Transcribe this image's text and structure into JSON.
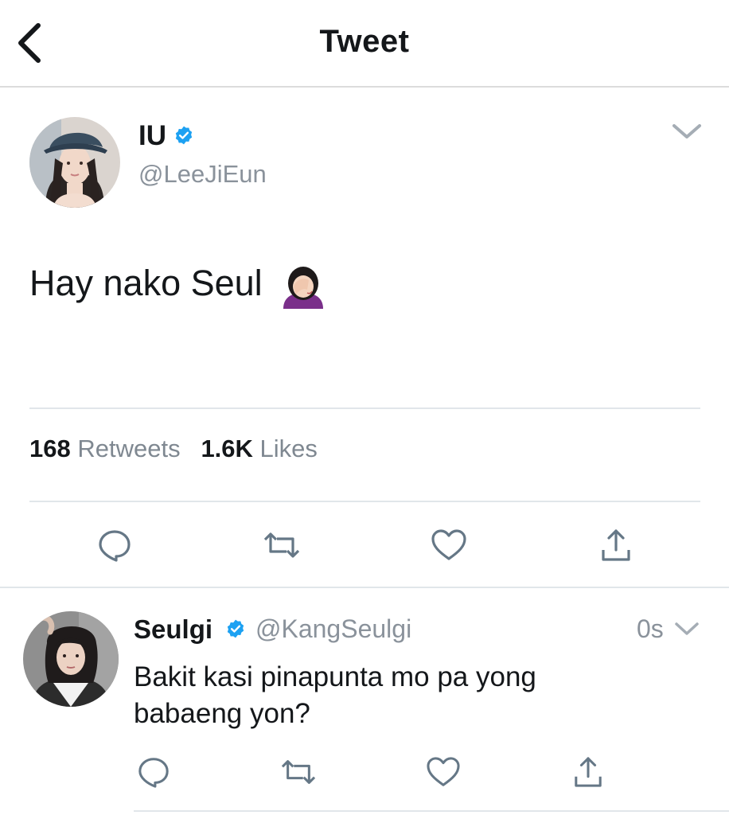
{
  "header": {
    "title": "Tweet"
  },
  "main_tweet": {
    "name": "IU",
    "handle": "@LeeJiEun",
    "text": "Hay nako Seul",
    "emoji": "🤦🏻‍♀️",
    "stats": {
      "retweets_count": "168",
      "retweets_label": "Retweets",
      "likes_count": "1.6K",
      "likes_label": "Likes"
    }
  },
  "reply": {
    "name": "Seulgi",
    "handle": "@KangSeulgi",
    "time": "0s",
    "text": "Bakit kasi pinapunta mo pa yong babaeng yon?"
  },
  "colors": {
    "icon": "#657786",
    "verified": "#1da1f2",
    "text": "#14171a",
    "secondary": "#8a929b"
  },
  "icons": [
    "chevron-left-icon",
    "chevron-down-icon",
    "verified-icon",
    "reply-icon",
    "retweet-icon",
    "like-icon",
    "share-icon"
  ]
}
